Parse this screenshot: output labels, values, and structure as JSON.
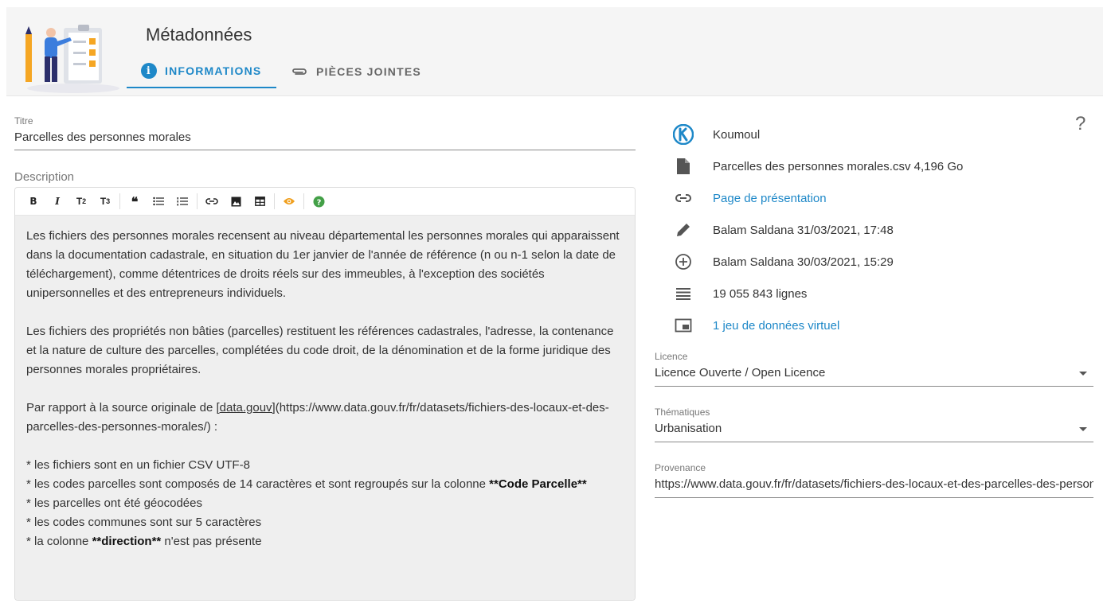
{
  "header": {
    "title": "Métadonnées",
    "tabs": [
      {
        "label": "INFORMATIONS",
        "icon": "info-icon",
        "active": true
      },
      {
        "label": "PIÈCES JOINTES",
        "icon": "paperclip-icon",
        "active": false
      }
    ]
  },
  "form": {
    "title_label": "Titre",
    "title_value": "Parcelles des personnes morales",
    "description_label": "Description",
    "toolbar": [
      "bold-icon",
      "italic-icon",
      "title2-icon",
      "title3-icon",
      "quote-icon",
      "bulleted-list-icon",
      "numbered-list-icon",
      "link-icon",
      "image-icon",
      "table-icon",
      "preview-eye-icon",
      "help-icon"
    ],
    "description": {
      "p1": "Les fichiers des personnes morales recensent au niveau départemental les personnes morales qui apparaissent dans la documentation cadastrale, en situation du 1er janvier de l'année de référence (n ou n-1 selon la date de téléchargement), comme détentrices de droits réels sur des immeubles, à l'exception des sociétés unipersonnelles et des entrepreneurs individuels.",
      "p2": "Les fichiers des propriétés non bâties (parcelles) restituent les références cadastrales, l'adresse, la contenance et la nature de culture des parcelles, complétées du code droit, de la dénomination et de la forme juridique des personnes morales propriétaires.",
      "p3_prefix": "Par rapport à la source originale de ",
      "p3_link": "[data.gouv]",
      "p3_suffix": "(https://www.data.gouv.fr/fr/datasets/fichiers-des-locaux-et-des-parcelles-des-personnes-morales/) :",
      "b1": "* les fichiers sont en un fichier CSV UTF-8",
      "b2_prefix": "* les codes parcelles sont composés de 14 caractères et sont regroupés sur la colonne ",
      "b2_bold": "**Code Parcelle**",
      "b3": "* les parcelles ont été géocodées",
      "b4": "* les codes communes sont sur 5 caractères",
      "b5_prefix": "* la colonne ",
      "b5_bold": "**direction**",
      "b5_suffix": " n'est pas présente"
    }
  },
  "sidebar": {
    "help": "?",
    "meta": [
      {
        "icon": "koumoul-logo-icon",
        "text": "Koumoul",
        "link": false
      },
      {
        "icon": "file-icon",
        "text": "Parcelles des personnes morales.csv 4,196 Go",
        "link": false
      },
      {
        "icon": "link-icon",
        "text": "Page de présentation",
        "link": true
      },
      {
        "icon": "pencil-icon",
        "text": "Balam Saldana 31/03/2021, 17:48",
        "link": false
      },
      {
        "icon": "plus-circle-icon",
        "text": "Balam Saldana 30/03/2021, 15:29",
        "link": false
      },
      {
        "icon": "lines-icon",
        "text": "19 055 843 lignes",
        "link": false
      },
      {
        "icon": "virtual-dataset-icon",
        "text": "1 jeu de données virtuel",
        "link": true
      }
    ],
    "licence_label": "Licence",
    "licence_value": "Licence Ouverte / Open Licence",
    "thematiques_label": "Thématiques",
    "thematiques_value": "Urbanisation",
    "provenance_label": "Provenance",
    "provenance_value": "https://www.data.gouv.fr/fr/datasets/fichiers-des-locaux-et-des-parcelles-des-personnes-morales/"
  },
  "colors": {
    "accent": "#1e88c8",
    "header_bg": "#f5f5f5",
    "editor_bg": "#efefef",
    "eye": "#f0a020",
    "help_green": "#43a047"
  }
}
